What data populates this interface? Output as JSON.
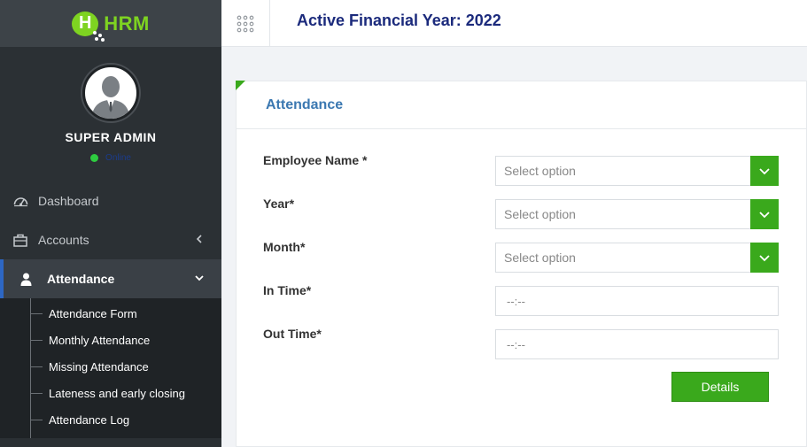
{
  "brand": {
    "logo_letter": "H",
    "logo_text": "HRM",
    "color": "#7ed321"
  },
  "profile": {
    "name": "SUPER ADMIN",
    "status": "Online"
  },
  "sidebar": {
    "items": [
      {
        "label": "Dashboard",
        "icon": "dashboard-icon"
      },
      {
        "label": "Accounts",
        "icon": "briefcase-icon"
      },
      {
        "label": "Attendance",
        "icon": "user-icon"
      }
    ],
    "attendance_submenu": [
      "Attendance Form",
      "Monthly Attendance",
      "Missing Attendance",
      "Lateness and early closing",
      "Attendance Log"
    ]
  },
  "topbar": {
    "title": "Active Financial Year: 2022"
  },
  "card": {
    "title": "Attendance",
    "fields": [
      {
        "label": "Employee Name *",
        "type": "select",
        "placeholder": "Select option"
      },
      {
        "label": "Year*",
        "type": "select",
        "placeholder": "Select option"
      },
      {
        "label": "Month*",
        "type": "select",
        "placeholder": "Select option"
      },
      {
        "label": "In Time*",
        "type": "time",
        "placeholder": "--:--"
      },
      {
        "label": "Out Time*",
        "type": "time",
        "placeholder": "--:--"
      }
    ],
    "submit_label": "Details"
  },
  "colors": {
    "accent": "#3aa91c",
    "sidebar": "#2b3034",
    "title": "#1b2a7c",
    "card_title": "#3b78b1"
  }
}
